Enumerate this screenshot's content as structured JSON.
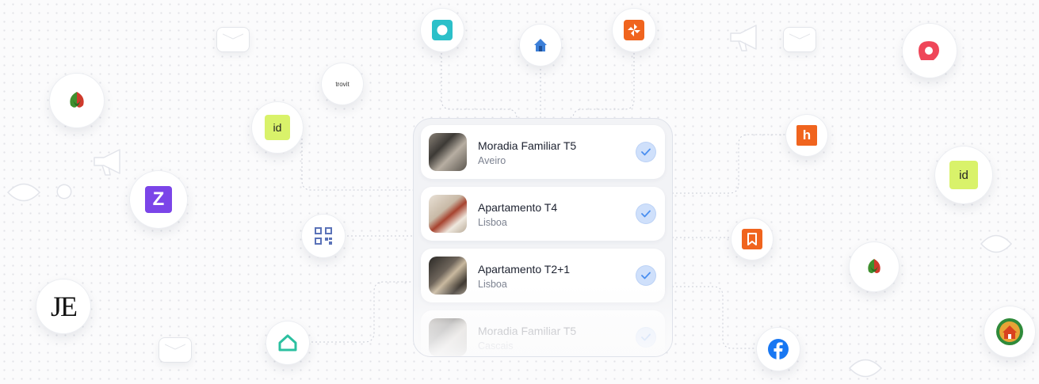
{
  "listings": [
    {
      "title": "Moradia Familiar T5",
      "location": "Aveiro",
      "selected": true
    },
    {
      "title": "Apartamento T4",
      "location": "Lisboa",
      "selected": true
    },
    {
      "title": "Apartamento T2+1",
      "location": "Lisboa",
      "selected": true
    },
    {
      "title": "Moradia Familiar T5",
      "location": "Cascais",
      "selected": true
    }
  ],
  "logos": {
    "trovit": "trovit",
    "idealista": "id",
    "je": "JE",
    "zome": "Z",
    "habitaclia": "h"
  },
  "colors": {
    "check_fill": "#cfe0fb",
    "check_mark": "#4a8ff0",
    "idealista": "#d9f26a",
    "zome": "#7b45e8",
    "orange": "#f0641e",
    "facebook": "#1877f2",
    "teal": "#2cc0c9",
    "red": "#ef4659"
  }
}
